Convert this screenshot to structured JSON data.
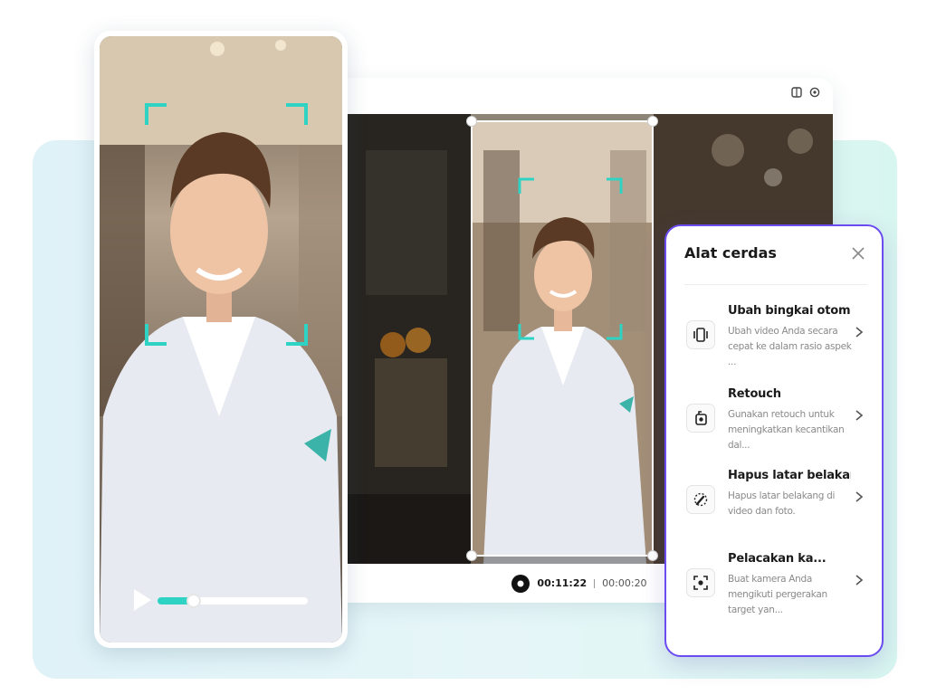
{
  "editor": {
    "timecode_current": "00:11:22",
    "timecode_total": "00:00:20"
  },
  "phone": {
    "progress": 0.24
  },
  "panel": {
    "title": "Alat cerdas",
    "items": [
      {
        "title": "Ubah bingkai otomatis",
        "description": "Ubah video Anda secara cepat ke dalam rasio aspek ...",
        "icon": "auto-reframe-icon"
      },
      {
        "title": "Retouch",
        "description": "Gunakan retouch untuk meningkatkan kecantikan dal...",
        "icon": "retouch-icon"
      },
      {
        "title": "Hapus latar belakang",
        "description": "Hapus latar belakang di video dan foto.",
        "icon": "remove-background-icon"
      },
      {
        "title": "Pelacakan ka...",
        "description": "Buat kamera Anda mengikuti pergerakan target yan...",
        "icon": "camera-tracking-icon"
      }
    ]
  },
  "colors": {
    "accent_purple": "#6b4cf0",
    "accent_teal": "#2fd3c4",
    "backdrop": "#e2f5f7"
  }
}
